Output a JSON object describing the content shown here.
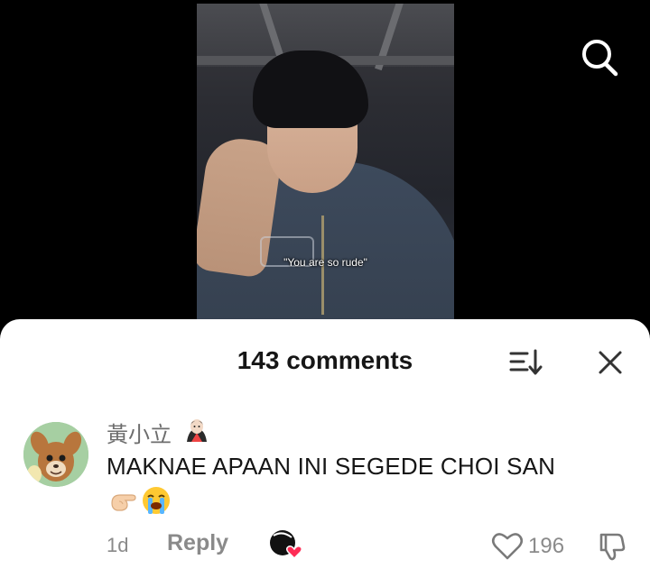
{
  "video": {
    "subtitle": "\"You are so rude\""
  },
  "header": {
    "search_icon": "search-icon"
  },
  "comments_panel": {
    "title": "143 comments",
    "sort_icon": "sort-icon",
    "close_icon": "close-icon"
  },
  "comment": {
    "username": "黃小立",
    "username_emoji": "vampire-emoji",
    "text": "MAKNAE APAAN INI SEGEDE CHOI SAN",
    "emojis": [
      "pointing-hand-emoji",
      "loudly-crying-emoji"
    ],
    "time": "1d",
    "reply_label": "Reply",
    "likes": "196",
    "creator_liked": true
  },
  "colors": {
    "sheet_bg": "#ffffff",
    "text_primary": "#161616",
    "text_secondary": "#8a8a8a",
    "creator_heart": "#fe2c55"
  }
}
